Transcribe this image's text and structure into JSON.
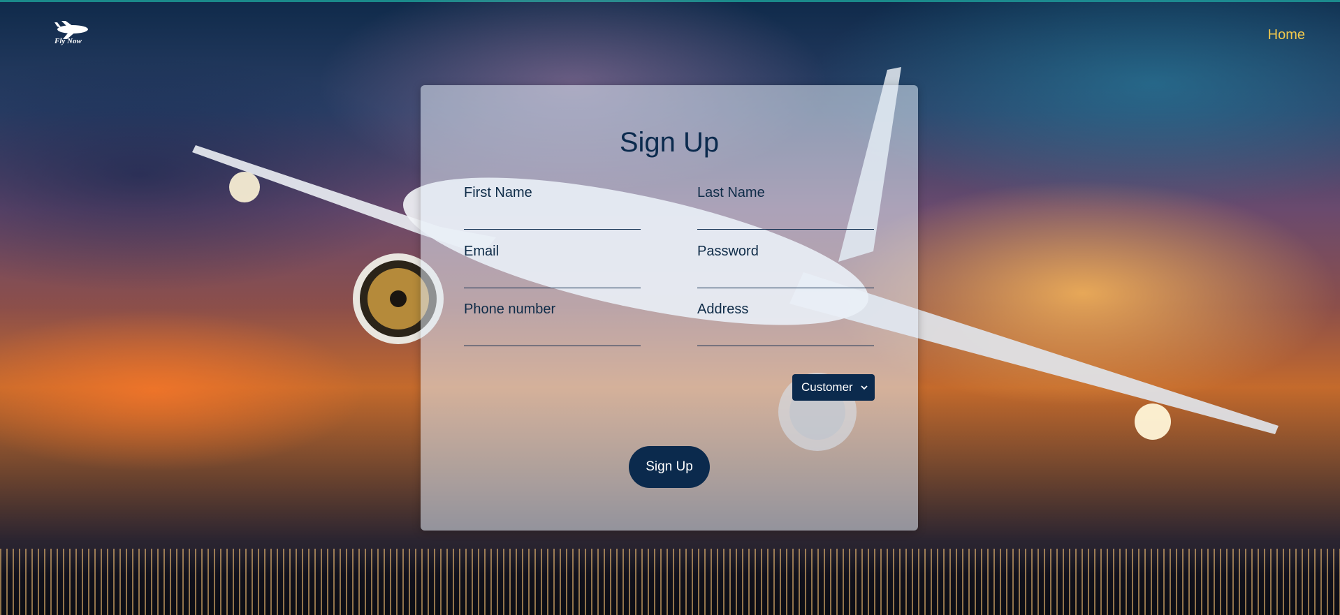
{
  "header": {
    "logo_text": "Fly Now",
    "home_link": "Home"
  },
  "form": {
    "title": "Sign Up",
    "fields": [
      {
        "label": "First Name",
        "value": ""
      },
      {
        "label": "Last Name",
        "value": ""
      },
      {
        "label": "Email",
        "value": ""
      },
      {
        "label": "Password",
        "value": ""
      },
      {
        "label": "Phone number",
        "value": ""
      },
      {
        "label": "Address",
        "value": ""
      }
    ],
    "role_select": {
      "selected": "Customer"
    },
    "submit_label": "Sign Up"
  },
  "colors": {
    "primary": "#0b2a4d",
    "home_link": "#f2c94c",
    "top_accent": "#1a8a8a"
  },
  "icons": {
    "logo": "airplane-logo-icon",
    "select_arrow": "chevron-down-icon"
  }
}
